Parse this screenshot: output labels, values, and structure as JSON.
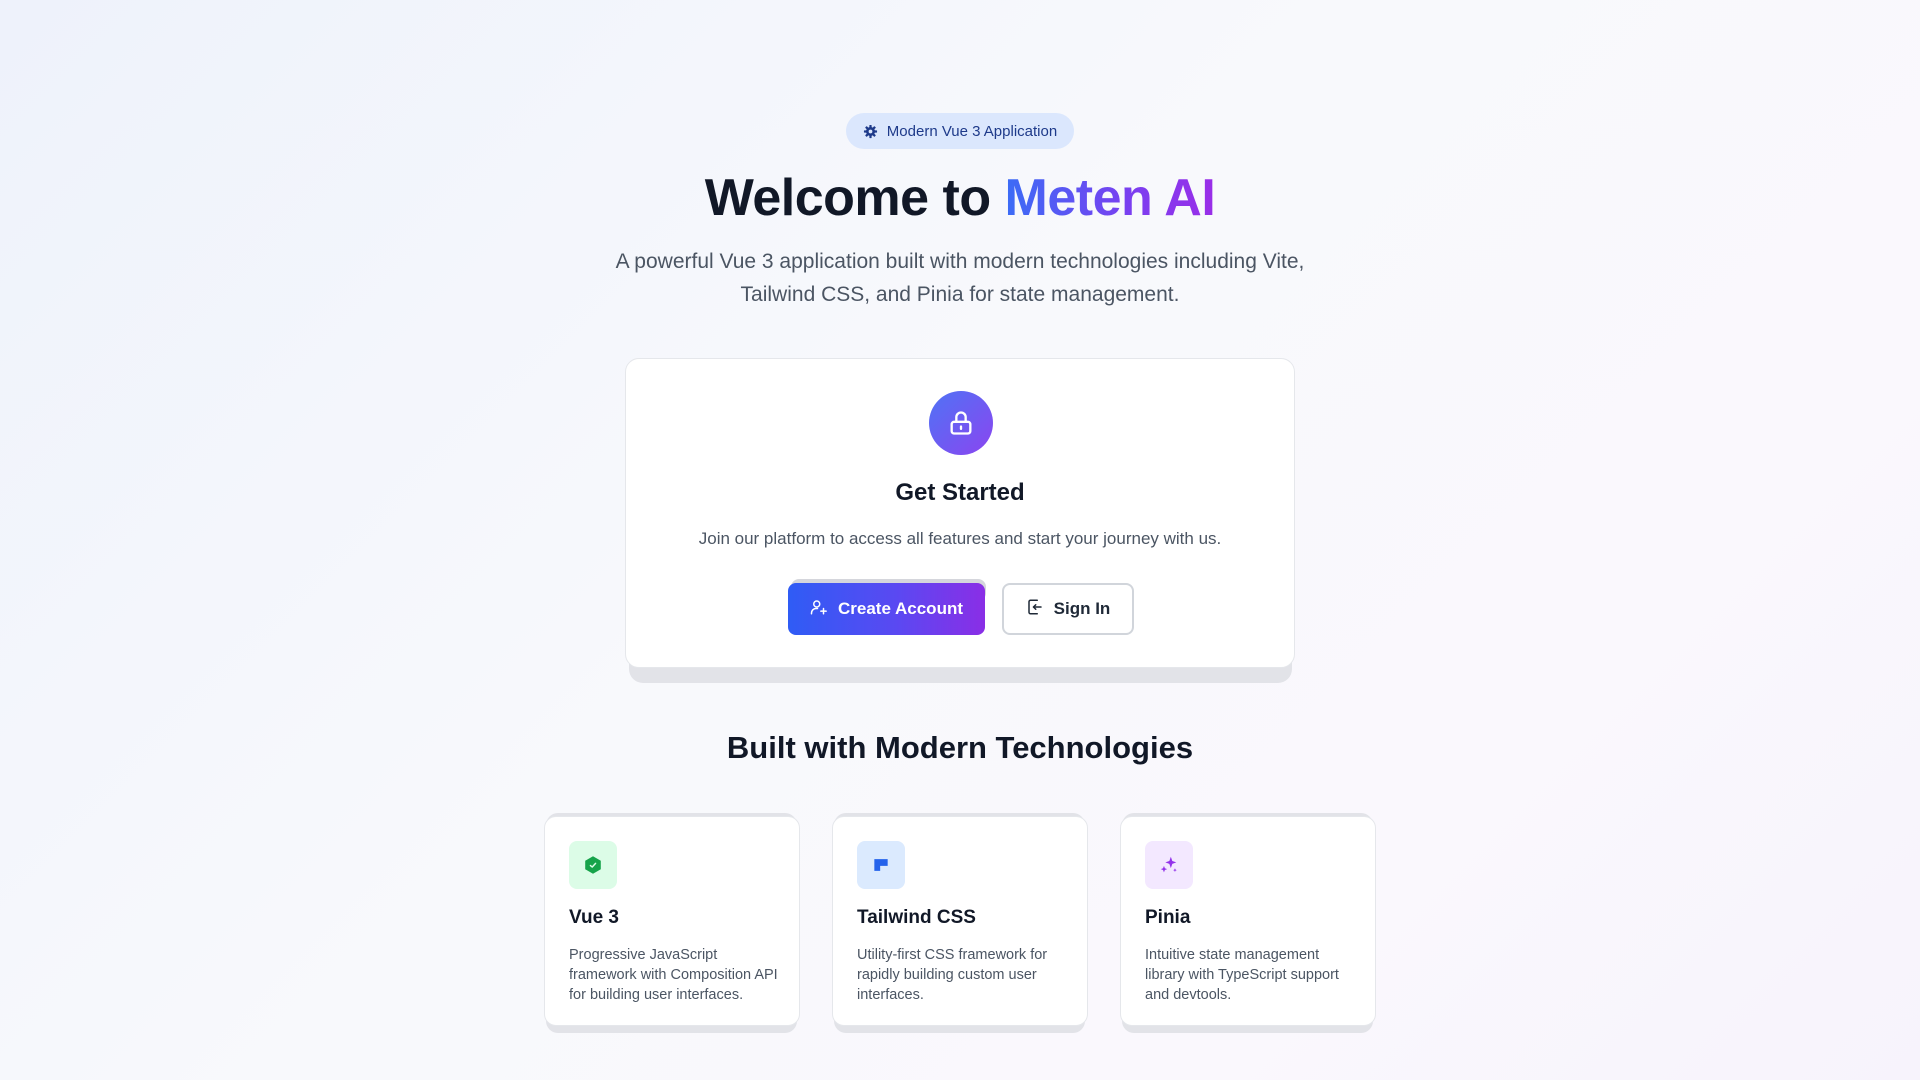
{
  "badge": {
    "icon": "gear-icon",
    "label": "Modern Vue 3 Application"
  },
  "hero": {
    "title_prefix": "Welcome to ",
    "title_accent": "Meten AI",
    "subtitle": "A powerful Vue 3 application built with modern technologies including Vite, Tailwind CSS, and Pinia for state management."
  },
  "get_started": {
    "icon": "lock-icon",
    "title": "Get Started",
    "description": "Join our platform to access all features and start your journey with us.",
    "create_account_label": "Create Account",
    "create_account_icon": "user-plus-icon",
    "sign_in_label": "Sign In",
    "sign_in_icon": "sign-in-icon"
  },
  "technologies": {
    "title": "Built with Modern Technologies",
    "items": [
      {
        "icon": "vue-icon",
        "title": "Vue 3",
        "description": "Progressive JavaScript framework with Composition API for building user interfaces."
      },
      {
        "icon": "tailwind-icon",
        "title": "Tailwind CSS",
        "description": "Utility-first CSS framework for rapidly building custom user interfaces."
      },
      {
        "icon": "sparkles-icon",
        "title": "Pinia",
        "description": "Intuitive state management library with TypeScript support and devtools."
      }
    ]
  },
  "colors": {
    "accent_blue": "#3b6cf6",
    "accent_purple": "#8a2ee6",
    "badge_bg": "#dbe7fd",
    "vue_green": "#16a34a",
    "tailwind_blue": "#2563eb",
    "pinia_purple": "#9333ea"
  }
}
